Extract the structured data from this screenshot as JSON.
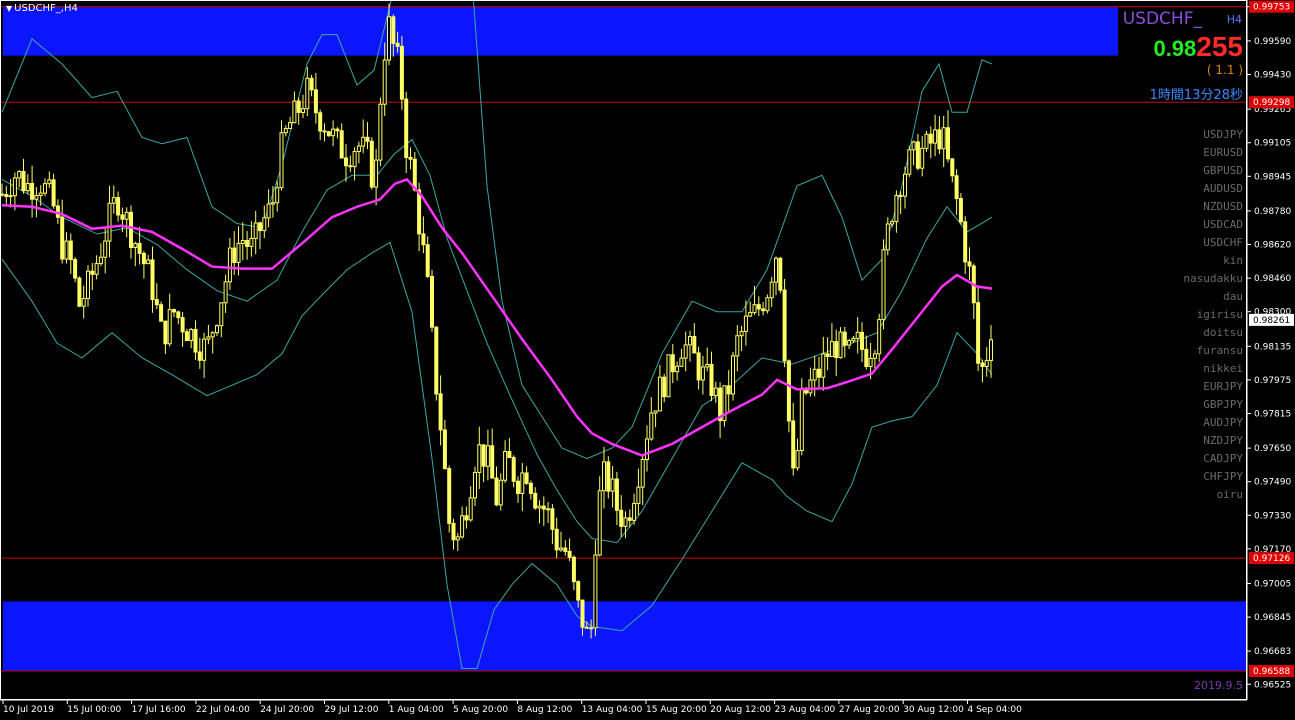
{
  "window": {
    "title": "USDCHF_,H4"
  },
  "overlay": {
    "symbol": "USDCHF_",
    "timeframe": "H4",
    "price_main": "0.98",
    "price_tail": "255",
    "spread": "( 1.1 )",
    "countdown": "1時間13分28秒",
    "symbols": [
      "USDJPY",
      "EURUSD",
      "GBPUSD",
      "AUDUSD",
      "NZDUSD",
      "USDCAD",
      "USDCHF",
      "kin",
      "nasudakku",
      "dau",
      "igirisu",
      "doitsu",
      "furansu",
      "nikkei",
      "EURJPY",
      "GBPJPY",
      "AUDJPY",
      "NZDJPY",
      "CADJPY",
      "CHFJPY",
      "oiru"
    ],
    "date_stamp": "2019.9.5"
  },
  "colors": {
    "background": "#000000",
    "candle": "#ffff66",
    "ma": "#ff33ff",
    "band": "#3aa7a7",
    "zone": "#0b16ff",
    "level_line": "#cc0000"
  },
  "chart_data": {
    "type": "candlestick",
    "symbol": "USDCHF_",
    "timeframe": "H4",
    "ylim": [
      0.9645,
      0.99785
    ],
    "price_ticks": [
      "0.99753",
      "0.99590",
      "0.99430",
      "0.99265",
      "0.99105",
      "0.98945",
      "0.98780",
      "0.98620",
      "0.98460",
      "0.98300",
      "0.98135",
      "0.97975",
      "0.97815",
      "0.97650",
      "0.97490",
      "0.97330",
      "0.97170",
      "0.97005",
      "0.96845",
      "0.96683",
      "0.96525"
    ],
    "level_labels": [
      {
        "price": 0.99753,
        "label": "0.99753"
      },
      {
        "price": 0.99298,
        "label": "0.99298"
      },
      {
        "price": 0.97126,
        "label": "0.97126"
      },
      {
        "price": 0.96588,
        "label": "0.96588"
      }
    ],
    "current_price": {
      "price": 0.98261,
      "label": "0.98261"
    },
    "zones": [
      {
        "from": 0.9952,
        "to": 0.99753
      },
      {
        "from": 0.96588,
        "to": 0.9692
      }
    ],
    "time_labels": [
      "10 Jul 2019",
      "15 Jul 00:00",
      "17 Jul 16:00",
      "22 Jul 04:00",
      "24 Jul 20:00",
      "29 Jul 12:00",
      "1 Aug 04:00",
      "5 Aug 20:00",
      "8 Aug 12:00",
      "13 Aug 04:00",
      "15 Aug 20:00",
      "20 Aug 12:00",
      "23 Aug 04:00",
      "27 Aug 20:00",
      "30 Aug 12:00",
      "4 Sep 04:00"
    ],
    "price_path": [
      [
        0,
        0.9886
      ],
      [
        10,
        0.9893
      ],
      [
        14,
        0.9896
      ],
      [
        25,
        0.989
      ],
      [
        38,
        0.9892
      ],
      [
        50,
        0.9883
      ],
      [
        60,
        0.9862
      ],
      [
        70,
        0.9852
      ],
      [
        77,
        0.9833
      ],
      [
        86,
        0.9842
      ],
      [
        97,
        0.9857
      ],
      [
        106,
        0.9872
      ],
      [
        115,
        0.9885
      ],
      [
        126,
        0.9872
      ],
      [
        138,
        0.9858
      ],
      [
        149,
        0.9845
      ],
      [
        160,
        0.9818
      ],
      [
        172,
        0.983
      ],
      [
        185,
        0.9822
      ],
      [
        197,
        0.9815
      ],
      [
        205,
        0.9812
      ],
      [
        215,
        0.983
      ],
      [
        222,
        0.9842
      ],
      [
        230,
        0.9858
      ],
      [
        240,
        0.9865
      ],
      [
        250,
        0.986
      ],
      [
        260,
        0.9872
      ],
      [
        270,
        0.988
      ],
      [
        278,
        0.9905
      ],
      [
        286,
        0.9918
      ],
      [
        295,
        0.9925
      ],
      [
        305,
        0.9935
      ],
      [
        315,
        0.9925
      ],
      [
        325,
        0.9918
      ],
      [
        335,
        0.991
      ],
      [
        345,
        0.9905
      ],
      [
        355,
        0.991
      ],
      [
        365,
        0.9905
      ],
      [
        373,
        0.989
      ],
      [
        380,
        0.9945
      ],
      [
        386,
        0.9968
      ],
      [
        392,
        0.9955
      ],
      [
        398,
        0.9945
      ],
      [
        404,
        0.991
      ],
      [
        410,
        0.9895
      ],
      [
        418,
        0.987
      ],
      [
        425,
        0.9845
      ],
      [
        432,
        0.9805
      ],
      [
        440,
        0.977
      ],
      [
        447,
        0.973
      ],
      [
        455,
        0.972
      ],
      [
        465,
        0.974
      ],
      [
        475,
        0.9765
      ],
      [
        485,
        0.976
      ],
      [
        495,
        0.974
      ],
      [
        505,
        0.976
      ],
      [
        515,
        0.975
      ],
      [
        525,
        0.9755
      ],
      [
        535,
        0.974
      ],
      [
        545,
        0.9735
      ],
      [
        555,
        0.972
      ],
      [
        565,
        0.9715
      ],
      [
        575,
        0.969
      ],
      [
        583,
        0.968
      ],
      [
        588,
        0.9668
      ],
      [
        593,
        0.972
      ],
      [
        600,
        0.9752
      ],
      [
        608,
        0.9748
      ],
      [
        616,
        0.9735
      ],
      [
        624,
        0.973
      ],
      [
        632,
        0.9745
      ],
      [
        640,
        0.9762
      ],
      [
        650,
        0.9785
      ],
      [
        660,
        0.9795
      ],
      [
        670,
        0.9805
      ],
      [
        680,
        0.9815
      ],
      [
        690,
        0.981
      ],
      [
        700,
        0.98
      ],
      [
        710,
        0.9795
      ],
      [
        718,
        0.9782
      ],
      [
        726,
        0.9792
      ],
      [
        735,
        0.9815
      ],
      [
        745,
        0.9825
      ],
      [
        755,
        0.983
      ],
      [
        765,
        0.984
      ],
      [
        775,
        0.986
      ],
      [
        780,
        0.9838
      ],
      [
        785,
        0.979
      ],
      [
        792,
        0.9745
      ],
      [
        800,
        0.9788
      ],
      [
        808,
        0.9795
      ],
      [
        816,
        0.98
      ],
      [
        825,
        0.981
      ],
      [
        835,
        0.9815
      ],
      [
        845,
        0.9808
      ],
      [
        855,
        0.9815
      ],
      [
        865,
        0.981
      ],
      [
        875,
        0.982
      ],
      [
        880,
        0.9848
      ],
      [
        888,
        0.9875
      ],
      [
        896,
        0.989
      ],
      [
        905,
        0.99
      ],
      [
        915,
        0.9905
      ],
      [
        925,
        0.9908
      ],
      [
        932,
        0.9912
      ],
      [
        940,
        0.9915
      ],
      [
        948,
        0.9895
      ],
      [
        956,
        0.988
      ],
      [
        963,
        0.986
      ],
      [
        970,
        0.9842
      ],
      [
        977,
        0.98
      ],
      [
        983,
        0.9805
      ],
      [
        990,
        0.9826
      ]
    ],
    "moving_average": {
      "color": "magenta",
      "points": [
        [
          0,
          0.98807
        ],
        [
          30,
          0.988
        ],
        [
          60,
          0.98765
        ],
        [
          90,
          0.98695
        ],
        [
          120,
          0.9871
        ],
        [
          150,
          0.9868
        ],
        [
          180,
          0.986
        ],
        [
          210,
          0.98515
        ],
        [
          240,
          0.98505
        ],
        [
          270,
          0.98505
        ],
        [
          300,
          0.98625
        ],
        [
          330,
          0.9875
        ],
        [
          355,
          0.988
        ],
        [
          378,
          0.98835
        ],
        [
          393,
          0.9891
        ],
        [
          405,
          0.9893
        ],
        [
          420,
          0.9885
        ],
        [
          440,
          0.987
        ],
        [
          460,
          0.9858
        ],
        [
          490,
          0.98375
        ],
        [
          520,
          0.9817
        ],
        [
          550,
          0.97975
        ],
        [
          575,
          0.978
        ],
        [
          590,
          0.9772
        ],
        [
          610,
          0.9767
        ],
        [
          640,
          0.97615
        ],
        [
          670,
          0.9767
        ],
        [
          700,
          0.9775
        ],
        [
          730,
          0.9783
        ],
        [
          760,
          0.97905
        ],
        [
          775,
          0.97975
        ],
        [
          795,
          0.9793
        ],
        [
          825,
          0.97935
        ],
        [
          845,
          0.97965
        ],
        [
          870,
          0.98005
        ],
        [
          890,
          0.9812
        ],
        [
          915,
          0.9827
        ],
        [
          940,
          0.9842
        ],
        [
          955,
          0.98475
        ],
        [
          975,
          0.9842
        ],
        [
          990,
          0.9841
        ]
      ]
    },
    "bands": {
      "upper": [
        [
          0,
          0.9925
        ],
        [
          30,
          0.996
        ],
        [
          60,
          0.9948
        ],
        [
          90,
          0.9932
        ],
        [
          115,
          0.9935
        ],
        [
          140,
          0.9913
        ],
        [
          160,
          0.991
        ],
        [
          185,
          0.9913
        ],
        [
          210,
          0.988
        ],
        [
          235,
          0.9872
        ],
        [
          260,
          0.987
        ],
        [
          280,
          0.99
        ],
        [
          305,
          0.9948
        ],
        [
          320,
          0.9962
        ],
        [
          335,
          0.9962
        ],
        [
          355,
          0.9938
        ],
        [
          372,
          0.9945
        ],
        [
          390,
          0.998
        ],
        [
          410,
          0.9998
        ],
        [
          425,
          1.0005
        ],
        [
          440,
          1.001
        ],
        [
          455,
          1.002
        ],
        [
          470,
          0.9998
        ],
        [
          485,
          0.989
        ],
        [
          500,
          0.9835
        ],
        [
          520,
          0.9795
        ],
        [
          540,
          0.978
        ],
        [
          560,
          0.9765
        ],
        [
          585,
          0.976
        ],
        [
          610,
          0.9765
        ],
        [
          630,
          0.9775
        ],
        [
          660,
          0.981
        ],
        [
          690,
          0.9835
        ],
        [
          715,
          0.983
        ],
        [
          740,
          0.983
        ],
        [
          765,
          0.985
        ],
        [
          780,
          0.987
        ],
        [
          795,
          0.989
        ],
        [
          820,
          0.9895
        ],
        [
          840,
          0.9875
        ],
        [
          860,
          0.9845
        ],
        [
          880,
          0.9855
        ],
        [
          900,
          0.989
        ],
        [
          920,
          0.9935
        ],
        [
          937,
          0.9948
        ],
        [
          950,
          0.9925
        ],
        [
          965,
          0.9925
        ],
        [
          980,
          0.995
        ],
        [
          990,
          0.9948
        ]
      ],
      "lower": [
        [
          0,
          0.9855
        ],
        [
          30,
          0.9835
        ],
        [
          55,
          0.9815
        ],
        [
          80,
          0.9808
        ],
        [
          110,
          0.982
        ],
        [
          140,
          0.9808
        ],
        [
          170,
          0.98
        ],
        [
          205,
          0.979
        ],
        [
          230,
          0.9795
        ],
        [
          255,
          0.98
        ],
        [
          280,
          0.981
        ],
        [
          300,
          0.9828
        ],
        [
          320,
          0.9838
        ],
        [
          345,
          0.985
        ],
        [
          370,
          0.9858
        ],
        [
          388,
          0.9863
        ],
        [
          410,
          0.983
        ],
        [
          430,
          0.976
        ],
        [
          445,
          0.97
        ],
        [
          460,
          0.966
        ],
        [
          475,
          0.966
        ],
        [
          492,
          0.9688
        ],
        [
          510,
          0.97
        ],
        [
          530,
          0.971
        ],
        [
          555,
          0.97
        ],
        [
          575,
          0.9685
        ],
        [
          590,
          0.968
        ],
        [
          620,
          0.9678
        ],
        [
          650,
          0.969
        ],
        [
          680,
          0.9712
        ],
        [
          710,
          0.9735
        ],
        [
          740,
          0.9758
        ],
        [
          770,
          0.975
        ],
        [
          785,
          0.9742
        ],
        [
          805,
          0.9735
        ],
        [
          830,
          0.973
        ],
        [
          850,
          0.9748
        ],
        [
          870,
          0.9775
        ],
        [
          890,
          0.9778
        ],
        [
          910,
          0.978
        ],
        [
          935,
          0.9795
        ],
        [
          955,
          0.982
        ],
        [
          975,
          0.981
        ],
        [
          990,
          0.98
        ]
      ],
      "middle": [
        [
          0,
          0.9893
        ],
        [
          30,
          0.9885
        ],
        [
          60,
          0.9875
        ],
        [
          95,
          0.9867
        ],
        [
          125,
          0.987
        ],
        [
          155,
          0.9862
        ],
        [
          185,
          0.985
        ],
        [
          215,
          0.984
        ],
        [
          245,
          0.9835
        ],
        [
          275,
          0.9845
        ],
        [
          300,
          0.9868
        ],
        [
          325,
          0.9888
        ],
        [
          350,
          0.9895
        ],
        [
          375,
          0.9895
        ],
        [
          392,
          0.9905
        ],
        [
          410,
          0.9912
        ],
        [
          428,
          0.9895
        ],
        [
          445,
          0.9865
        ],
        [
          465,
          0.984
        ],
        [
          485,
          0.9815
        ],
        [
          510,
          0.9788
        ],
        [
          535,
          0.9762
        ],
        [
          555,
          0.9745
        ],
        [
          575,
          0.973
        ],
        [
          590,
          0.9722
        ],
        [
          615,
          0.972
        ],
        [
          640,
          0.9735
        ],
        [
          670,
          0.976
        ],
        [
          700,
          0.9785
        ],
        [
          730,
          0.9795
        ],
        [
          760,
          0.9808
        ],
        [
          790,
          0.9805
        ],
        [
          820,
          0.981
        ],
        [
          850,
          0.9815
        ],
        [
          875,
          0.982
        ],
        [
          900,
          0.984
        ],
        [
          925,
          0.9865
        ],
        [
          945,
          0.988
        ],
        [
          965,
          0.9868
        ],
        [
          990,
          0.9875
        ]
      ]
    }
  }
}
